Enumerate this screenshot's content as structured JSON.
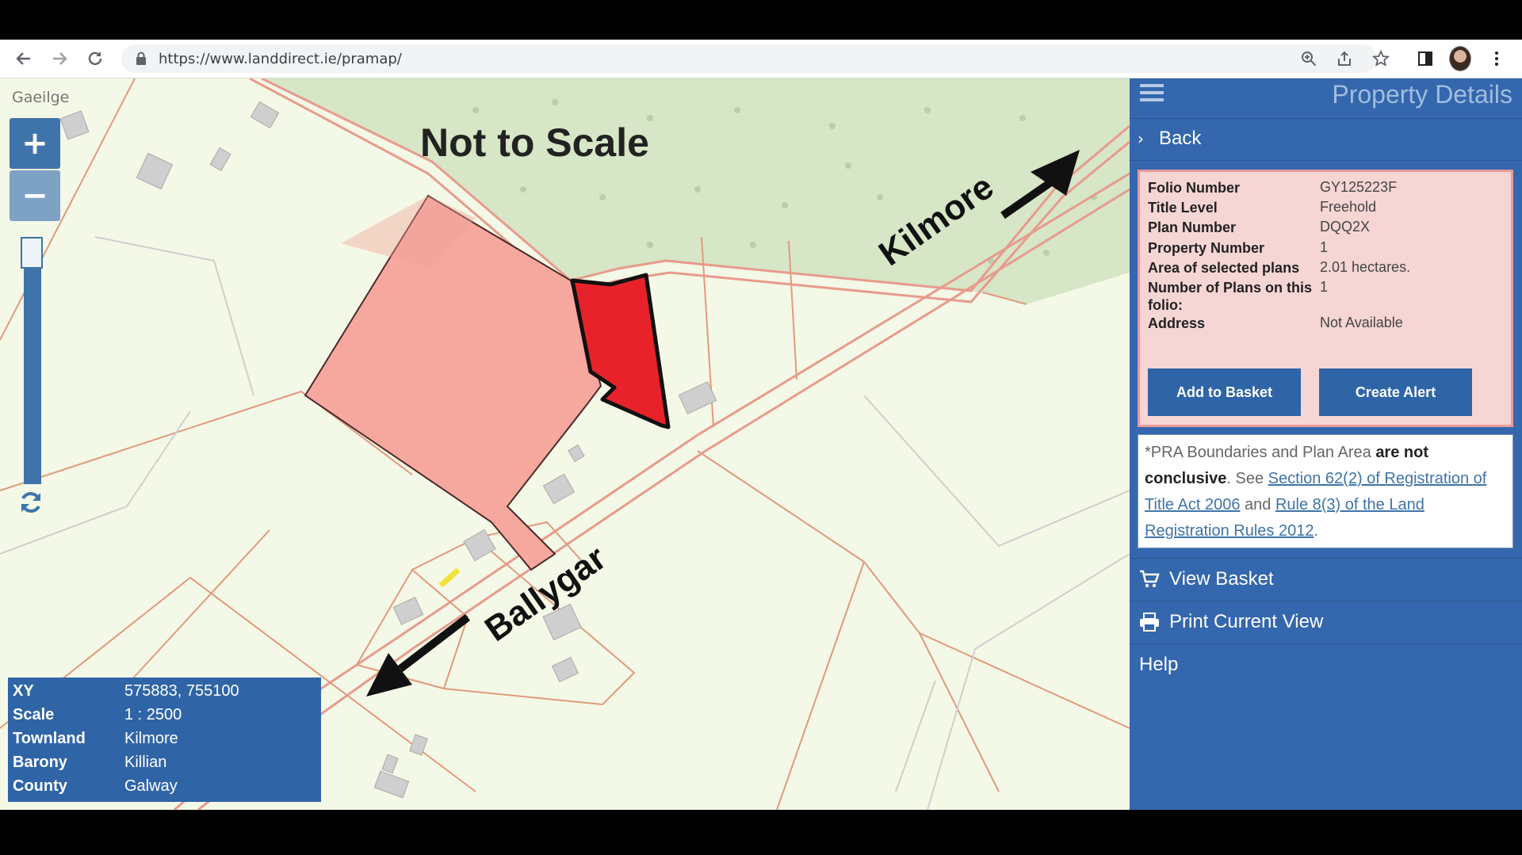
{
  "browser": {
    "url": "https://www.landdirect.ie/pramap/"
  },
  "map": {
    "language_link": "Gaeilge",
    "zoom_in": "+",
    "zoom_out": "−",
    "title": "Not to Scale",
    "road_labels": [
      "Kilmore",
      "Ballygar"
    ]
  },
  "info": {
    "rows": [
      {
        "label": "XY",
        "value": "575883, 755100"
      },
      {
        "label": "Scale",
        "value": "1 : 2500"
      },
      {
        "label": "Townland",
        "value": "Kilmore"
      },
      {
        "label": "Barony",
        "value": "Killian"
      },
      {
        "label": "County",
        "value": "Galway"
      }
    ]
  },
  "panel": {
    "title": "Property Details",
    "back": "Back",
    "details": [
      {
        "label": "Folio Number",
        "value": "GY125223F"
      },
      {
        "label": "Title Level",
        "value": "Freehold"
      },
      {
        "label": "Plan Number",
        "value": "DQQ2X"
      },
      {
        "label": "Property Number",
        "value": "1"
      },
      {
        "label": "Area of selected plans",
        "value": "2.01 hectares."
      },
      {
        "label": "Number of Plans on this folio:",
        "value": "1"
      },
      {
        "label": "Address",
        "value": "Not Available"
      }
    ],
    "add_to_basket": "Add to Basket",
    "create_alert": "Create Alert",
    "notice": {
      "part1": "*PRA Boundaries and Plan Area ",
      "bold": "are not conclusive",
      "part2": ". See ",
      "link1": "Section 62(2) of Registration of Title Act 2006",
      "part3": " and ",
      "link2": "Rule 8(3) of the Land Registration Rules 2012",
      "part4": "."
    },
    "menu": {
      "view_basket": "View Basket",
      "print_view": "Print Current View",
      "help": "Help"
    }
  },
  "colors": {
    "panel_blue": "#3467ad",
    "selected_plot": "#e8222a",
    "folio_area": "#f4a9a0",
    "forest": "#d7e6c9"
  }
}
